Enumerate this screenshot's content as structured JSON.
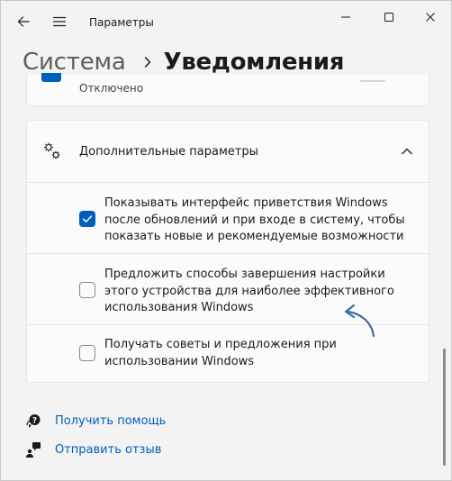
{
  "window": {
    "title": "Параметры"
  },
  "breadcrumb": {
    "parent": "Система",
    "current": "Уведомления"
  },
  "previous_item": {
    "state": "Отключено"
  },
  "expander": {
    "title": "Дополнительные параметры",
    "options": [
      {
        "label": "Показывать интерфейс приветствия Windows после обновлений и при входе в систему, чтобы показать новые и рекомендуемые возможности",
        "checked": true
      },
      {
        "label": "Предложить способы завершения настройки этого устройства для наиболее эффективного использования Windows",
        "checked": false
      },
      {
        "label": "Получать советы и предложения при использовании Windows",
        "checked": false
      }
    ]
  },
  "links": {
    "help": "Получить помощь",
    "feedback": "Отправить отзыв"
  },
  "colors": {
    "accent": "#005fb8",
    "background": "#f3f3f3",
    "card": "#fbfbfb"
  },
  "icons": [
    "back-arrow-icon",
    "hamburger-menu-icon",
    "minimize-icon",
    "maximize-icon",
    "close-icon",
    "chevron-right-icon",
    "gears-icon",
    "chevron-up-icon",
    "checkmark-icon",
    "help-icon",
    "feedback-icon"
  ]
}
